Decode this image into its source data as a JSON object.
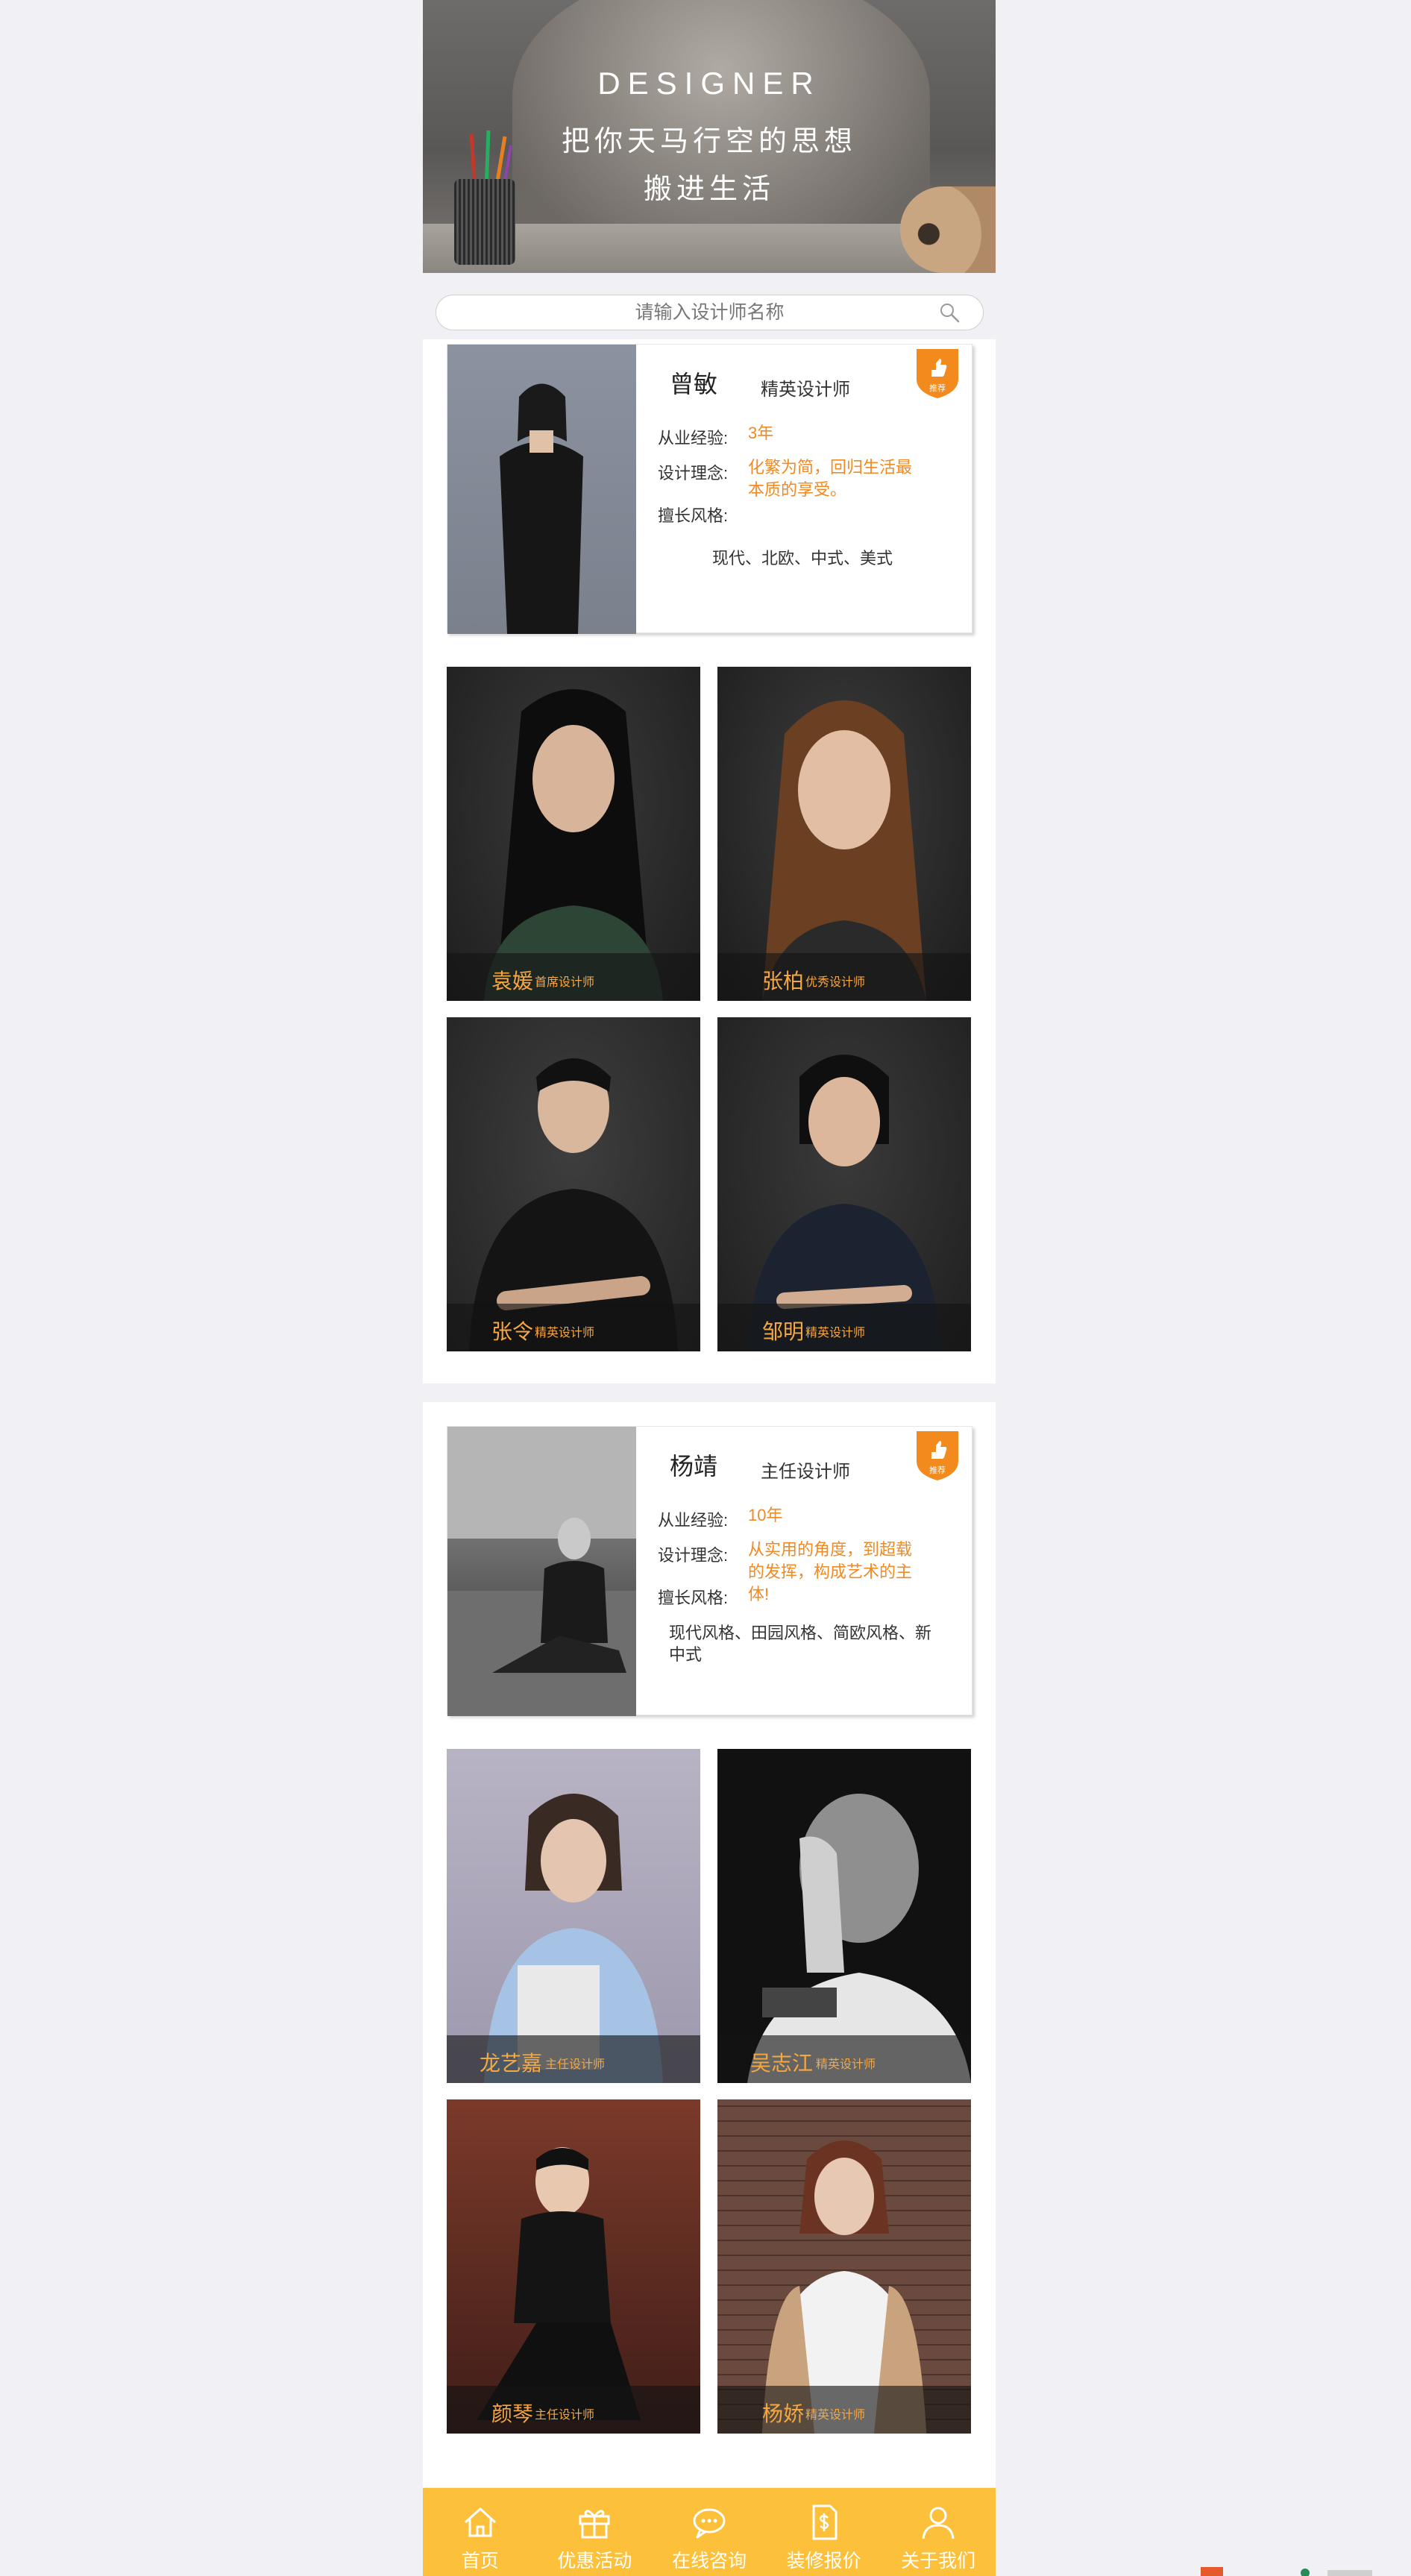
{
  "banner": {
    "title": "DESIGNER",
    "line1": "把你天马行空的思想",
    "line2": "搬进生活"
  },
  "search": {
    "placeholder": "请输入设计师名称",
    "icon": "search-icon"
  },
  "labels": {
    "experience": "从业经验:",
    "philosophy": "设计理念:",
    "styles": "擅长风格:",
    "badge": "推荐"
  },
  "sections": [
    {
      "featured": {
        "name": "曾敏",
        "title": "精英设计师",
        "experience": "3年",
        "philosophy_lines": [
          "化繁为简，回归生活最",
          "本质的享受。"
        ],
        "style_lines": [
          "现代、北欧、中式、美式"
        ]
      },
      "designers": [
        {
          "name": "袁媛",
          "role": "首席设计师"
        },
        {
          "name": "张柏",
          "role": "优秀设计师"
        },
        {
          "name": "张令",
          "role": "精英设计师"
        },
        {
          "name": "邹明",
          "role": "精英设计师"
        }
      ]
    },
    {
      "featured": {
        "name": "杨靖",
        "title": "主任设计师",
        "experience": "10年",
        "philosophy_lines": [
          "从实用的角度，到超载",
          "的发挥，构成艺术的主",
          "体!"
        ],
        "style_lines": [
          "现代风格、田园风格、简欧风格、新",
          "中式"
        ]
      },
      "designers": [
        {
          "name": "龙艺嘉",
          "role": "主任设计师"
        },
        {
          "name": "吴志江",
          "role": "精英设计师"
        },
        {
          "name": "颜琴",
          "role": "主任设计师"
        },
        {
          "name": "杨娇",
          "role": "精英设计师"
        }
      ]
    }
  ],
  "nav": [
    {
      "label": "首页",
      "icon": "home-icon"
    },
    {
      "label": "优惠活动",
      "icon": "gift-icon"
    },
    {
      "label": "在线咨询",
      "icon": "chat-icon"
    },
    {
      "label": "装修报价",
      "icon": "price-icon"
    },
    {
      "label": "关于我们",
      "icon": "user-icon"
    }
  ],
  "colors": {
    "accent": "#f08a24",
    "nav_bg": "#fdc03a",
    "caption_text": "#f5a742",
    "page_bg": "#f0f0f5"
  }
}
